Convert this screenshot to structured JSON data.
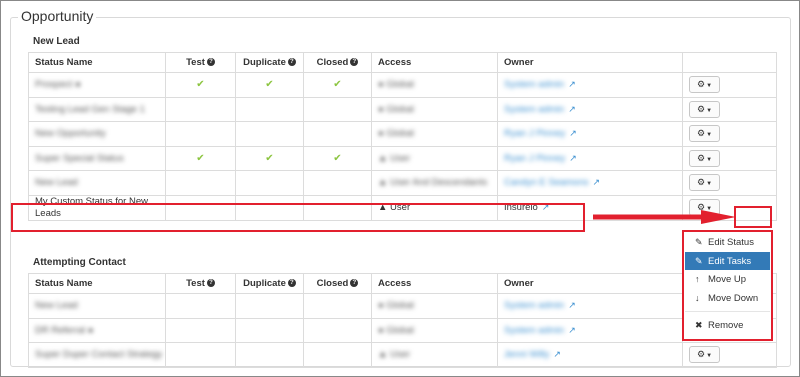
{
  "legend": "Opportunity",
  "colors": {
    "accent": "#337ab7",
    "highlight": "#e2202e",
    "check": "#8cc540",
    "link": "#3a8fd0"
  },
  "columns": {
    "status": "Status Name",
    "test": "Test",
    "duplicate": "Duplicate",
    "closed": "Closed",
    "access": "Access",
    "owner": "Owner"
  },
  "sections": [
    {
      "title": "New Lead",
      "rows": [
        {
          "name": "Prospect",
          "name_icon": true,
          "test": true,
          "duplicate": true,
          "closed": true,
          "access": "Global",
          "owner": "System admin",
          "blurred": true,
          "gear": true
        },
        {
          "name": "Testing Lead Gen Stage 1",
          "test": false,
          "duplicate": false,
          "closed": false,
          "access": "Global",
          "owner": "System admin",
          "blurred": true,
          "gear": true
        },
        {
          "name": "New Opportunity",
          "test": false,
          "duplicate": false,
          "closed": false,
          "access": "Global",
          "owner": "Ryan J Pinney",
          "blurred": true,
          "gear": true
        },
        {
          "name": "Super Special Status",
          "test": true,
          "duplicate": true,
          "closed": true,
          "access": "User",
          "owner": "Ryan J Pinney",
          "blurred": true,
          "gear": true
        },
        {
          "name": "New Lead",
          "test": false,
          "duplicate": false,
          "closed": false,
          "access": "User And Descendants",
          "owner": "Candyn E Seamons",
          "blurred": true,
          "gear": true
        },
        {
          "name": "My Custom Status for New Leads",
          "test": false,
          "duplicate": false,
          "closed": false,
          "access": "User",
          "owner": "Insureio",
          "blurred": false,
          "gear": true
        }
      ]
    },
    {
      "title": "Attempting Contact",
      "rows": [
        {
          "name": "New Lead",
          "test": false,
          "duplicate": false,
          "closed": false,
          "access": "Global",
          "owner": "System admin",
          "blurred": true,
          "gear": false
        },
        {
          "name": "DR Referral",
          "name_icon": true,
          "test": false,
          "duplicate": false,
          "closed": false,
          "access": "Global",
          "owner": "System admin",
          "blurred": true,
          "gear": false
        },
        {
          "name": "Super Duper Contact Strategy",
          "test": false,
          "duplicate": false,
          "closed": false,
          "access": "User",
          "owner": "Jenni Willy",
          "blurred": true,
          "gear": true
        }
      ]
    }
  ],
  "menu": {
    "items": [
      {
        "label": "Edit Status",
        "icon": "edit-icon",
        "active": false
      },
      {
        "label": "Edit Tasks",
        "icon": "edit-icon",
        "active": true
      },
      {
        "label": "Move Up",
        "icon": "move-up-icon",
        "active": false
      },
      {
        "label": "Move Down",
        "icon": "move-down-icon",
        "active": false
      }
    ],
    "remove": {
      "label": "Remove",
      "icon": "trash-icon"
    }
  }
}
